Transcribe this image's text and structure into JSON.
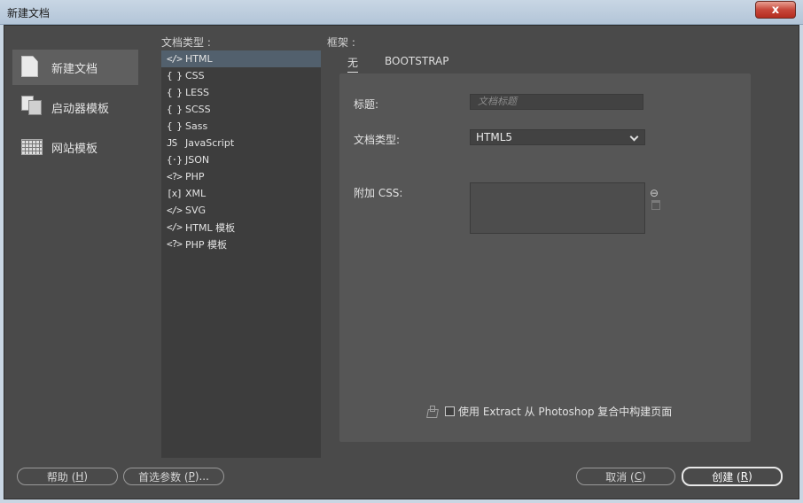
{
  "window": {
    "title": "新建文档",
    "close_label": "x"
  },
  "nav": {
    "items": [
      {
        "label": "新建文档",
        "icon": "document-icon",
        "active": true
      },
      {
        "label": "启动器模板",
        "icon": "starter-template-icon",
        "active": false
      },
      {
        "label": "网站模板",
        "icon": "site-template-icon",
        "active": false
      }
    ]
  },
  "doc_types": {
    "label": "文档类型 :",
    "items": [
      {
        "glyph": "</>",
        "label": "HTML",
        "selected": true
      },
      {
        "glyph": "{ }",
        "label": "CSS"
      },
      {
        "glyph": "{ }",
        "label": "LESS"
      },
      {
        "glyph": "{ }",
        "label": "SCSS"
      },
      {
        "glyph": "{ }",
        "label": "Sass"
      },
      {
        "glyph": "JS",
        "label": "JavaScript"
      },
      {
        "glyph": "{·}",
        "label": "JSON"
      },
      {
        "glyph": "<?>",
        "label": "PHP"
      },
      {
        "glyph": "[x]",
        "label": "XML"
      },
      {
        "glyph": "</>",
        "label": "SVG"
      },
      {
        "glyph": "</>",
        "label": "HTML 模板"
      },
      {
        "glyph": "<?>",
        "label": "PHP 模板"
      }
    ]
  },
  "framework": {
    "label": "框架 :",
    "tabs": [
      {
        "label": "无",
        "active": true
      },
      {
        "label": "BOOTSTRAP",
        "active": false
      }
    ]
  },
  "form": {
    "title_label": "标题:",
    "title_placeholder": "文档标题",
    "doctype_label": "文档类型:",
    "doctype_value": "HTML5",
    "css_label": "附加 CSS:",
    "link_icon": "⊖",
    "photoshop_label": "使用 Extract 从 Photoshop 复合中构建页面"
  },
  "buttons": {
    "help": {
      "text": "帮助 (",
      "key": "H",
      "end": ")"
    },
    "prefs": {
      "text": "首选参数 (",
      "key": "P",
      "end": ")..."
    },
    "cancel": {
      "text": "取消 (",
      "key": "C",
      "end": ")"
    },
    "create": {
      "text": "创建 (",
      "key": "R",
      "end": ")"
    }
  }
}
